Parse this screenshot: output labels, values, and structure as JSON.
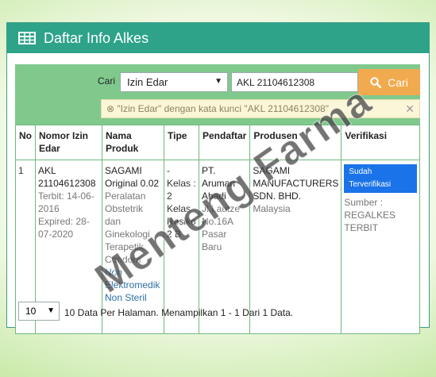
{
  "header": {
    "title": "Daftar Info Alkes",
    "icon": "table-icon"
  },
  "search": {
    "label": "Cari",
    "type_selected": "Izin Edar",
    "keyword_value": "AKL 21104612308",
    "button_label": "Cari",
    "filter_note": "\"Izin Edar\" dengan kata kunci \"AKL 21104612308\""
  },
  "table": {
    "headers": [
      "No",
      "Nomor Izin Edar",
      "Nama Produk",
      "Tipe",
      "Pendaftar",
      "Produsen",
      "Verifikasi"
    ],
    "rows": [
      {
        "no": "1",
        "izin_number": "AKL 21104612308",
        "izin_terbit": "Terbit: 14-06-2016",
        "izin_expired": "Expired: 28-07-2020",
        "product_name": "SAGAMI Original 0.02",
        "product_desc": "Peralatan Obstetrik dan Ginekologi Terapetik Condom",
        "product_link": "Non Elektromedik Non Steril",
        "tipe": "- Kelas : 2 Kelas Resiko 2 B",
        "pendaftar_name": "PT. Aruman Abadi",
        "pendaftar_addr": "Jl.Lautze No.16A Pasar Baru",
        "produsen_name": "SAGAMI MANUFACTURERS SDN. BHD.",
        "produsen_country": "Malaysia",
        "verifikasi_badge": "Sudah Terverifikasi",
        "verifikasi_source": "Sumber : REGALKES TERBIT"
      }
    ]
  },
  "footer": {
    "per_page": "10",
    "summary": "10 Data Per Halaman. Menampilkan 1 - 1 Dari 1 Data."
  },
  "watermark": "Menteng Farma",
  "colors": {
    "header": "#2ea38a",
    "body": "#80c98d",
    "button": "#f2aa4f",
    "badge": "#1a73e8"
  }
}
